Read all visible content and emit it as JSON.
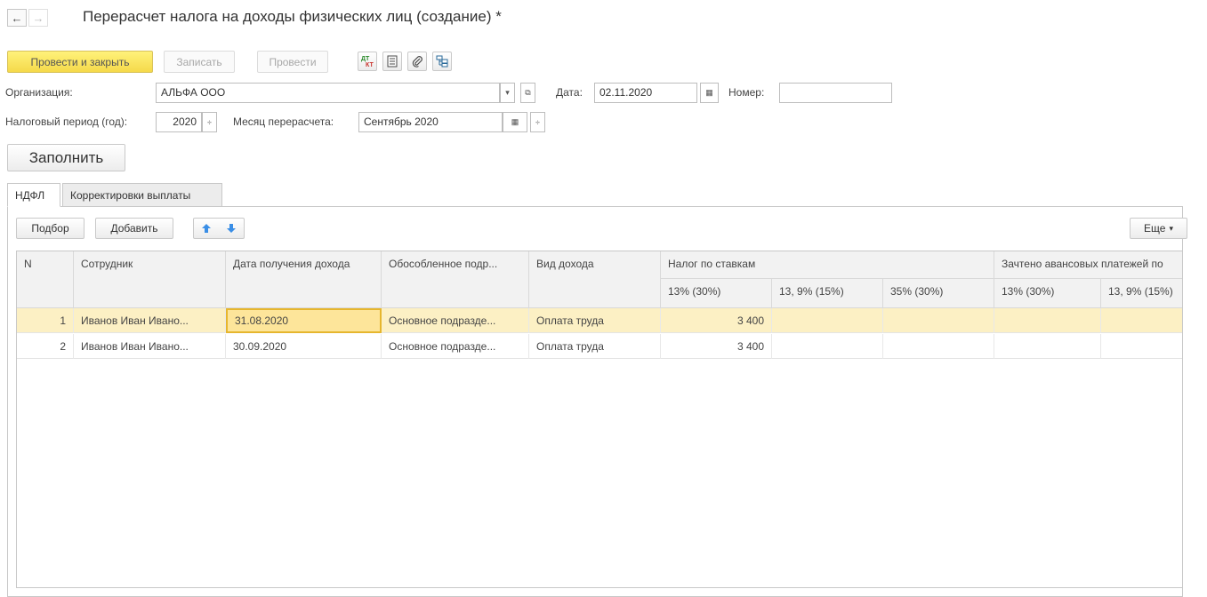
{
  "window": {
    "title": "Перерасчет налога на доходы физических лиц (создание) *"
  },
  "toolbar": {
    "post_close_label": "Провести и закрыть",
    "save_label": "Записать",
    "post_label": "Провести"
  },
  "form": {
    "org_label": "Организация:",
    "org_value": "АЛЬФА ООО",
    "date_label": "Дата:",
    "date_value": "02.11.2020",
    "number_label": "Номер:",
    "number_value": "",
    "period_label": "Налоговый период (год):",
    "period_value": "2020",
    "month_label": "Месяц перерасчета:",
    "month_value": "Сентябрь 2020",
    "fill_label": "Заполнить"
  },
  "tabs": [
    {
      "label": "НДФЛ",
      "active": true
    },
    {
      "label": "Корректировки выплаты",
      "active": false
    }
  ],
  "table_toolbar": {
    "select_label": "Подбор",
    "add_label": "Добавить",
    "more_label": "Еще"
  },
  "table": {
    "headers": {
      "n": "N",
      "employee": "Сотрудник",
      "income_date": "Дата получения дохода",
      "division": "Обособленное подр...",
      "income_type": "Вид дохода",
      "tax_group": "Налог по ставкам",
      "advance_group": "Зачтено авансовых платежей по",
      "tax_13": "13% (30%)",
      "tax_9": "13, 9% (15%)",
      "tax_35": "35% (30%)",
      "adv_13": "13% (30%)",
      "adv_9": "13, 9% (15%)"
    },
    "rows": [
      {
        "n": "1",
        "employee": "Иванов Иван Ивано...",
        "income_date": "31.08.2020",
        "division": "Основное подразде...",
        "income_type": "Оплата труда",
        "tax_13": "3 400",
        "selected": true
      },
      {
        "n": "2",
        "employee": "Иванов Иван Ивано...",
        "income_date": "30.09.2020",
        "division": "Основное подразде...",
        "income_type": "Оплата труда",
        "tax_13": "3 400",
        "selected": false
      }
    ]
  },
  "colors": {
    "primary_button": "#f5d94a",
    "selected_row": "#fcf0c4",
    "focus_cell": "#fde59a",
    "arrow_blue": "#3a8ee6"
  }
}
